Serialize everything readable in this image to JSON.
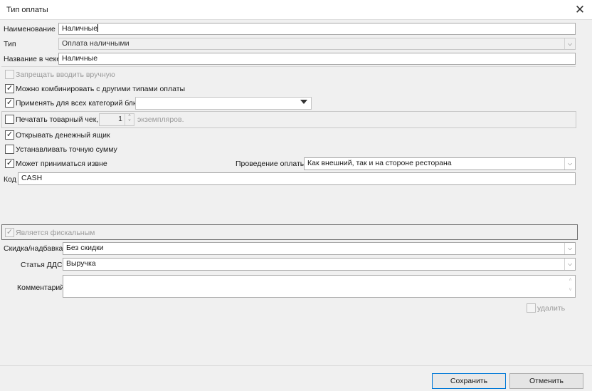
{
  "window": {
    "title": "Тип оплаты",
    "close_icon": "close-icon"
  },
  "fields": {
    "name_label": "Наименование",
    "name_value": "Наличные",
    "type_label": "Тип",
    "type_value": "Оплата наличными",
    "receipt_label": "Название в чеке",
    "receipt_value": "Наличные",
    "code_label": "Код",
    "code_value": "CASH"
  },
  "options": {
    "forbid_manual": "Запрещать вводить вручную",
    "combine": "Можно комбинировать с другими типами оплаты",
    "apply_all": "Применять для всех категорий блюд",
    "print_receipt": "Печатать товарный чек,",
    "copies_value": "1",
    "copies_suffix": "экземпляров.",
    "open_drawer": "Открывать денежный ящик",
    "exact_sum": "Устанавливать точную сумму",
    "external": "Может приниматься извне",
    "processing_label": "Проведение оплаты:",
    "processing_value": "Как внешний, так и на стороне ресторана"
  },
  "fiscal": {
    "label": "Является фискальным"
  },
  "bottom": {
    "discount_label": "Скидка/надбавка",
    "discount_value": "Без скидки",
    "dds_label": "Статья ДДС",
    "dds_value": "Выручка",
    "comment_label": "Комментарий",
    "delete_label": "удалить"
  },
  "actions": {
    "save": "Сохранить",
    "cancel": "Отменить"
  }
}
